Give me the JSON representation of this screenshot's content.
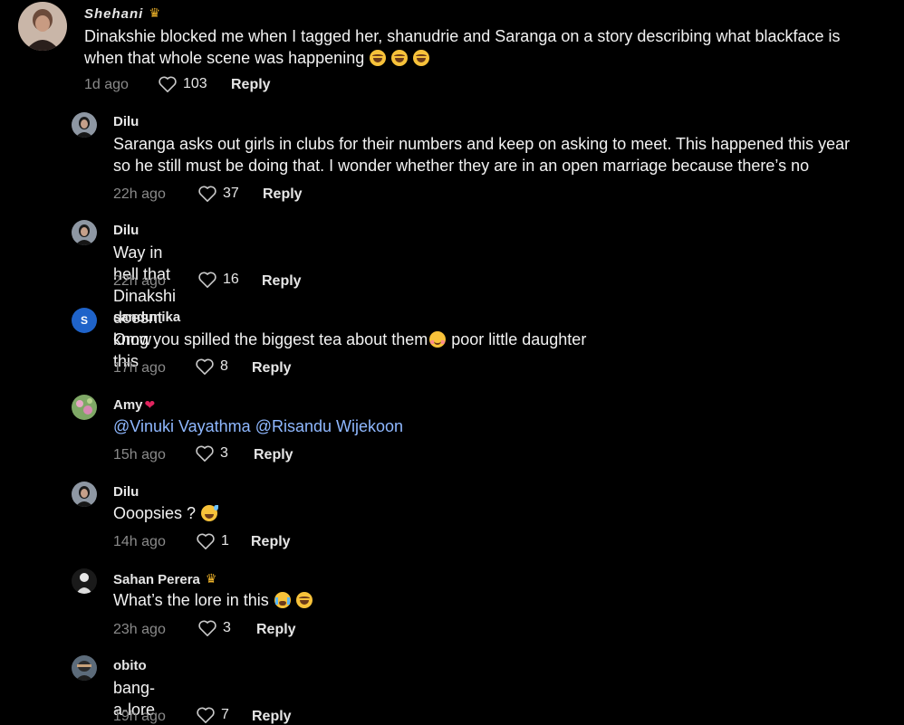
{
  "comments": [
    {
      "username": "Shehani",
      "badge": "♛",
      "text_lines": [
        "Dinakshie blocked me when I tagged her, shanudrie and Saranga on a story describing what blackface is",
        "when that whole scene was happening"
      ],
      "emojis": [
        "laugh",
        "laugh",
        "laugh"
      ],
      "time": "1d ago",
      "likes": "103",
      "reply": "Reply"
    },
    {
      "username": "Dilu",
      "text_lines": [
        "Saranga asks out girls in clubs for their numbers and keep on asking to meet. This happened this year",
        "so he still must be doing that. I wonder whether they are in an open marriage because there’s no"
      ],
      "time": "22h ago",
      "likes": "37",
      "reply": "Reply"
    },
    {
      "username": "Dilu",
      "text": "Way in hell that Dinakshi doesnt know this",
      "time": "22h ago",
      "likes": "16",
      "reply": "Reply"
    },
    {
      "username": "sandunika",
      "avatar_letter": "S",
      "text": "Omg you spilled the biggest tea about them",
      "text_after": "poor little daughter",
      "time": "17h ago",
      "likes": "8",
      "reply": "Reply"
    },
    {
      "username": "Amy",
      "heart": "❤",
      "mention1": "@Vinuki Vayathma",
      "mention2": "@Risandu Wijekoon",
      "time": "15h ago",
      "likes": "3",
      "reply": "Reply"
    },
    {
      "username": "Dilu",
      "text": "Ooopsies ?",
      "time": "14h ago",
      "likes": "1",
      "reply": "Reply"
    },
    {
      "username": "Sahan Perera",
      "badge": "♛",
      "text": "What’s the lore in this",
      "time": "23h ago",
      "likes": "3",
      "reply": "Reply"
    },
    {
      "username": "obito",
      "text": "bang-a-lore",
      "time": "19h ago",
      "likes": "7",
      "reply": "Reply"
    }
  ],
  "colors": {
    "background": "#000000",
    "meta": "#8a8a8a",
    "mention": "#8fb8ff",
    "avatar_s": "#1f63c9"
  },
  "icons": [
    "heart-outline-icon"
  ]
}
